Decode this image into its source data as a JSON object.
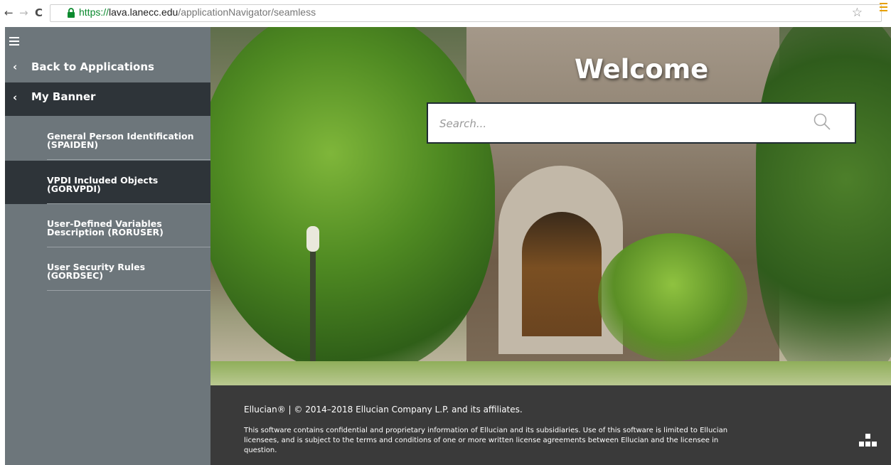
{
  "browser": {
    "url_scheme": "https://",
    "url_host": "lava.lanecc.edu",
    "url_path": "/applicationNavigator/seamless"
  },
  "sidebar": {
    "back_label": "Back to Applications",
    "section_label": "My Banner",
    "items": [
      {
        "label": "General Person Identification (SPAIDEN)",
        "active": false
      },
      {
        "label": "VPDI Included Objects (GORVPDI)",
        "active": true
      },
      {
        "label": "User-Defined Variables Description (RORUSER)",
        "active": false
      },
      {
        "label": "User Security Rules (GORDSEC)",
        "active": false
      }
    ]
  },
  "hero": {
    "title": "Welcome"
  },
  "search": {
    "placeholder": "Search..."
  },
  "footer": {
    "copyright": "Ellucian® | © 2014–2018 Ellucian Company L.P. and its affiliates.",
    "legal": "This software contains confidential and proprietary information of Ellucian and its subsidiaries. Use of this software is limited to Ellucian licensees, and is subject to the terms and conditions of one or more written license agreements between Ellucian and the licensee in question."
  },
  "colors": {
    "sidebar_bg": "#6d767b",
    "sidebar_active": "#2e3439",
    "footer_bg": "#3a3a3a",
    "secure_green": "#0b8a2e"
  },
  "icons": [
    "back-arrow-icon",
    "forward-arrow-icon",
    "reload-icon",
    "lock-icon",
    "star-icon",
    "browser-menu-icon",
    "hamburger-icon",
    "chevron-left-icon",
    "search-icon",
    "ellucian-logo-icon"
  ]
}
